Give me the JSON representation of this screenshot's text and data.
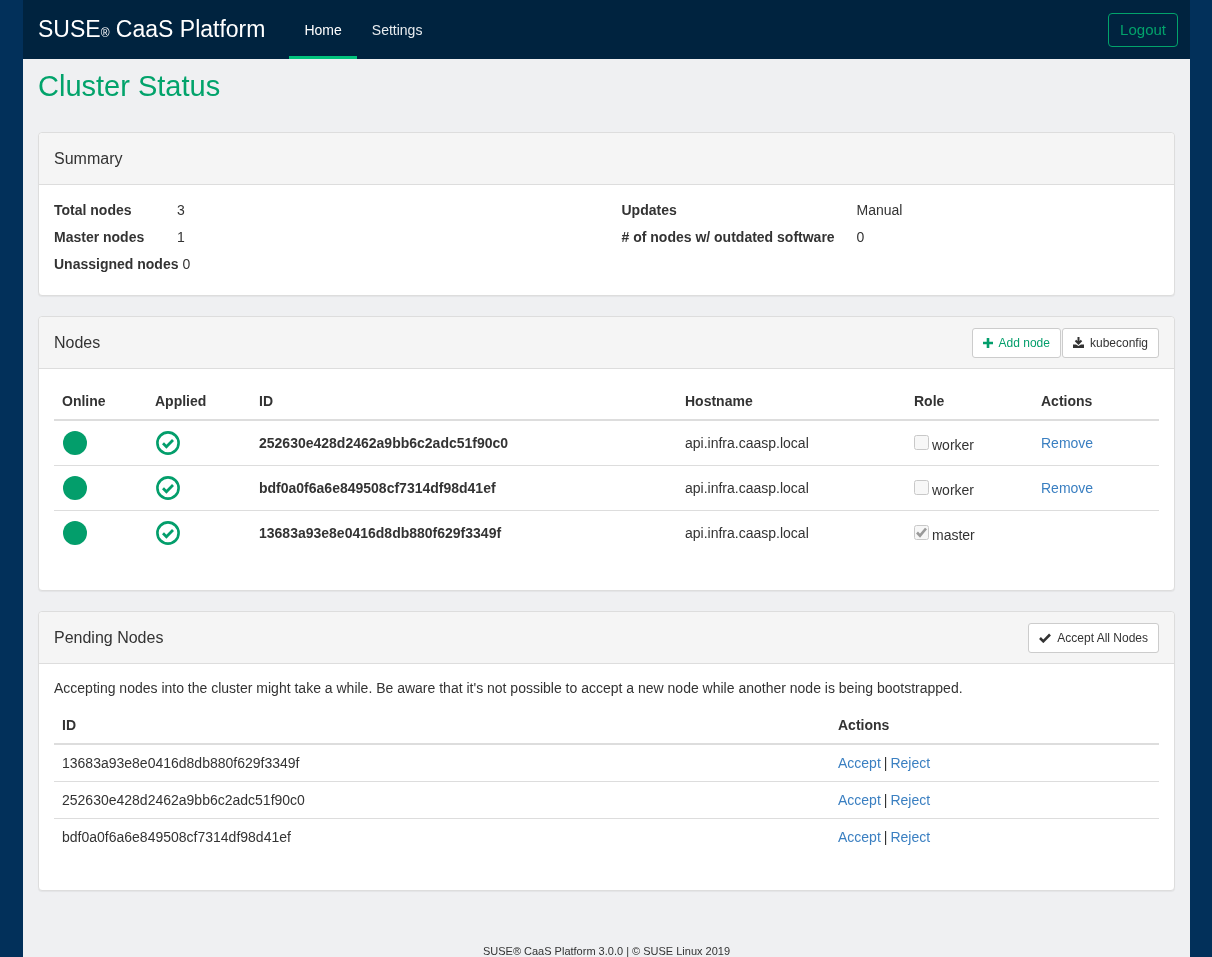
{
  "navbar": {
    "brand": "SUSE$_{®}$ CaaS Platform",
    "tabs": [
      {
        "label": "Home",
        "selected": true
      },
      {
        "label": "Settings",
        "selected": false
      }
    ],
    "logout": "Logout"
  },
  "page_title": "Cluster Status",
  "summary": {
    "title": "Summary",
    "groups": [
      {
        "items": [
          {
            "label": "Total nodes",
            "value": "3"
          },
          {
            "label": "Master nodes",
            "value": "1"
          },
          {
            "label": "Unassigned nodes",
            "value": "0"
          }
        ]
      },
      {
        "items": [
          {
            "label": "Updates",
            "value": "Manual"
          },
          {
            "label": "# of nodes w/ outdated software",
            "value": "0"
          }
        ]
      }
    ]
  },
  "nodes": {
    "title": "Nodes",
    "buttons": [
      {
        "label": "Add node",
        "kind": "add"
      },
      {
        "label": "kubeconfig",
        "kind": "download"
      }
    ],
    "columns": [
      "Online",
      "Applied",
      "ID",
      "Hostname",
      "Role",
      "Actions"
    ],
    "rows": [
      {
        "online": true,
        "applied": true,
        "id": "252630e428d2462a9bb6c2adc51f90c0",
        "hostname": "api.infra.caasp.local",
        "role": {
          "label": "worker",
          "checked": false
        },
        "action": "Remove"
      },
      {
        "online": true,
        "applied": true,
        "id": "bdf0a0f6a6e849508cf7314df98d41ef",
        "hostname": "api.infra.caasp.local",
        "role": {
          "label": "worker",
          "checked": false
        },
        "action": "Remove"
      },
      {
        "online": true,
        "applied": true,
        "id": "13683a93e8e0416d8db880f629f3349f",
        "hostname": "api.infra.caasp.local",
        "role": {
          "label": "master",
          "checked": true
        }
      }
    ]
  },
  "pending": {
    "title": "Pending Nodes",
    "button": {
      "label": "Accept All Nodes"
    },
    "note": "Accepting nodes into the cluster might take a while. Be aware that it's not possible to accept a new node while another node is being bootstrapped.",
    "columns": [
      "ID",
      "Actions"
    ],
    "rows": [
      {
        "id": "13683a93e8e0416d8db880f629f3349f",
        "accept": "Accept",
        "separator": "|",
        "reject": "Reject"
      },
      {
        "id": "252630e428d2462a9bb6c2adc51f90c0",
        "accept": "Accept",
        "separator": "|",
        "reject": "Reject"
      },
      {
        "id": "bdf0a0f6a6e849508cf7314df98d41ef",
        "accept": "Accept",
        "separator": "|",
        "reject": "Reject"
      }
    ]
  },
  "footer": "SUSE® CaaS Platform 3.0.0 | © SUSE Linux 2019"
}
